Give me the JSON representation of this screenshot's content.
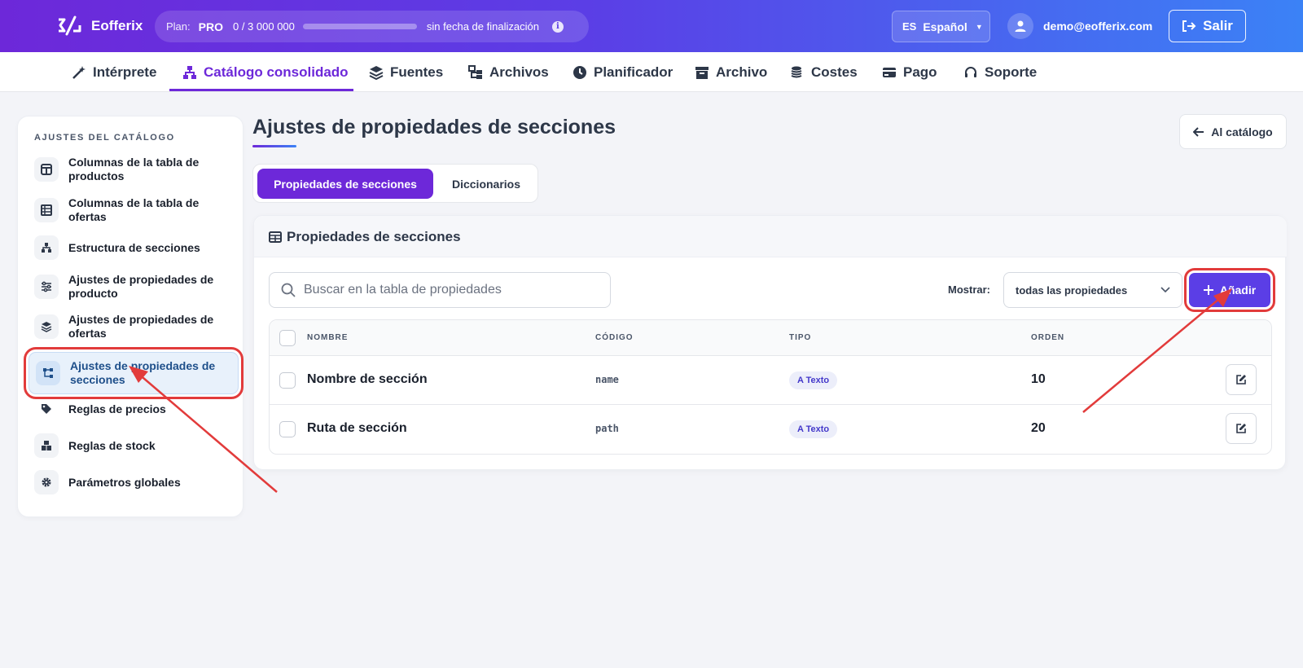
{
  "app": {
    "name": "Eofferix",
    "plan_label": "Plan:",
    "plan_name": "PRO",
    "plan_usage": "0  /  3 000 000",
    "plan_progress": 0,
    "plan_end": "sin fecha de finalización",
    "lang_code": "ES",
    "lang_name": "Español",
    "user_email": "demo@eofferix.com",
    "logout_label": "Salir"
  },
  "nav": {
    "items": [
      {
        "label": "Intérprete",
        "icon": "magic-wand-icon"
      },
      {
        "label": "Catálogo consolidado",
        "icon": "sitemap-icon",
        "active": true
      },
      {
        "label": "Fuentes",
        "icon": "layers-icon"
      },
      {
        "label": "Archivos",
        "icon": "folder-tree-icon"
      },
      {
        "label": "Planificador",
        "icon": "clock-icon"
      },
      {
        "label": "Archivo",
        "icon": "archive-icon"
      },
      {
        "label": "Costes",
        "icon": "coins-icon"
      },
      {
        "label": "Pago",
        "icon": "credit-card-icon"
      },
      {
        "label": "Soporte",
        "icon": "headset-icon"
      }
    ]
  },
  "sidebar": {
    "title": "AJUSTES DEL CATÁLOGO",
    "items": [
      {
        "label": "Columnas de la tabla de productos",
        "icon": "columns-icon"
      },
      {
        "label": "Columnas de la tabla de ofertas",
        "icon": "table-list-icon"
      },
      {
        "label": "Estructura de secciones",
        "icon": "hierarchy-icon"
      },
      {
        "label": "Ajustes de propiedades de producto",
        "icon": "sliders-icon"
      },
      {
        "label": "Ajustes de propiedades de ofertas",
        "icon": "layers-icon"
      },
      {
        "label": "Ajustes de propiedades de secciones",
        "icon": "diagram-icon",
        "active": true
      },
      {
        "label": "Reglas de precios",
        "icon": "tags-icon"
      },
      {
        "label": "Reglas de stock",
        "icon": "boxes-icon"
      },
      {
        "label": "Parámetros globales",
        "icon": "gear-icon"
      }
    ]
  },
  "main": {
    "title": "Ajustes de propiedades de secciones",
    "back_label": "Al catálogo",
    "tabs": [
      "Propiedades de secciones",
      "Diccionarios"
    ],
    "card_title": "Propiedades de secciones",
    "search_placeholder": "Buscar en la tabla de propiedades",
    "show_label": "Mostrar:",
    "show_value": "todas las propiedades",
    "add_label": "Añadir",
    "columns": [
      "NOMBRE",
      "CÓDIGO",
      "TIPO",
      "ORDEN"
    ],
    "rows": [
      {
        "name": "Nombre de sección",
        "code": "name",
        "type": "A Texto",
        "order": "10"
      },
      {
        "name": "Ruta de sección",
        "code": "path",
        "type": "A Texto",
        "order": "20"
      }
    ]
  },
  "colors": {
    "primary": "#6d28d9",
    "accent": "#5b3ee6",
    "highlight": "#e23b3b"
  }
}
